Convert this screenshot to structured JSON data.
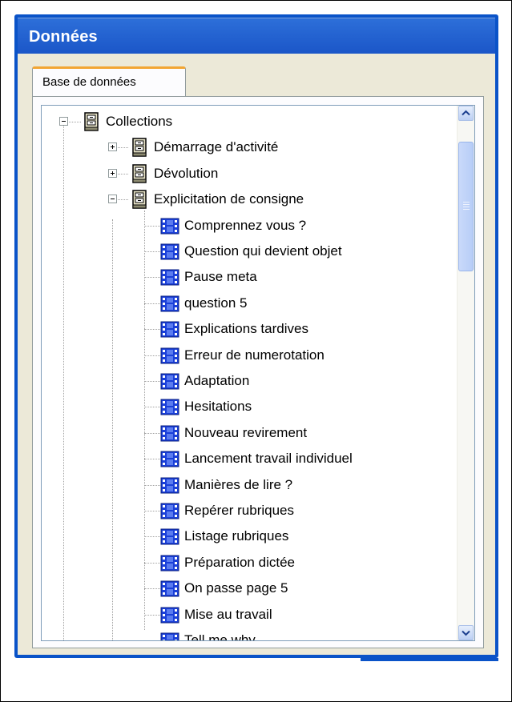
{
  "panel": {
    "title": "Données",
    "tab_label": "Base de données"
  },
  "tree": {
    "root": {
      "label": "Collections",
      "icon": "cabinet-icon",
      "expanded": true
    },
    "collections": [
      {
        "label": "Démarrage d'activité",
        "expanded": false
      },
      {
        "label": "Dévolution",
        "expanded": false
      },
      {
        "label": "Explicitation de consigne",
        "expanded": true
      }
    ],
    "items": [
      "Comprennez vous ?",
      "Question qui devient objet",
      "Pause meta",
      "question 5",
      "Explications tardives",
      "Erreur de numerotation",
      "Adaptation",
      "Hesitations",
      "Nouveau revirement",
      "Lancement travail individuel",
      "Manières de lire ?",
      "Repérer rubriques",
      "Listage rubriques",
      "Préparation dictée",
      "On passe page 5",
      "Mise au travail",
      "Tell me why"
    ]
  },
  "colors": {
    "title_bar": "#0a53c8",
    "tab_accent": "#f2a533",
    "film_icon": "#1a3fd8"
  },
  "scrollbar": {
    "up": "chevron-up-icon",
    "down": "chevron-down-icon"
  }
}
